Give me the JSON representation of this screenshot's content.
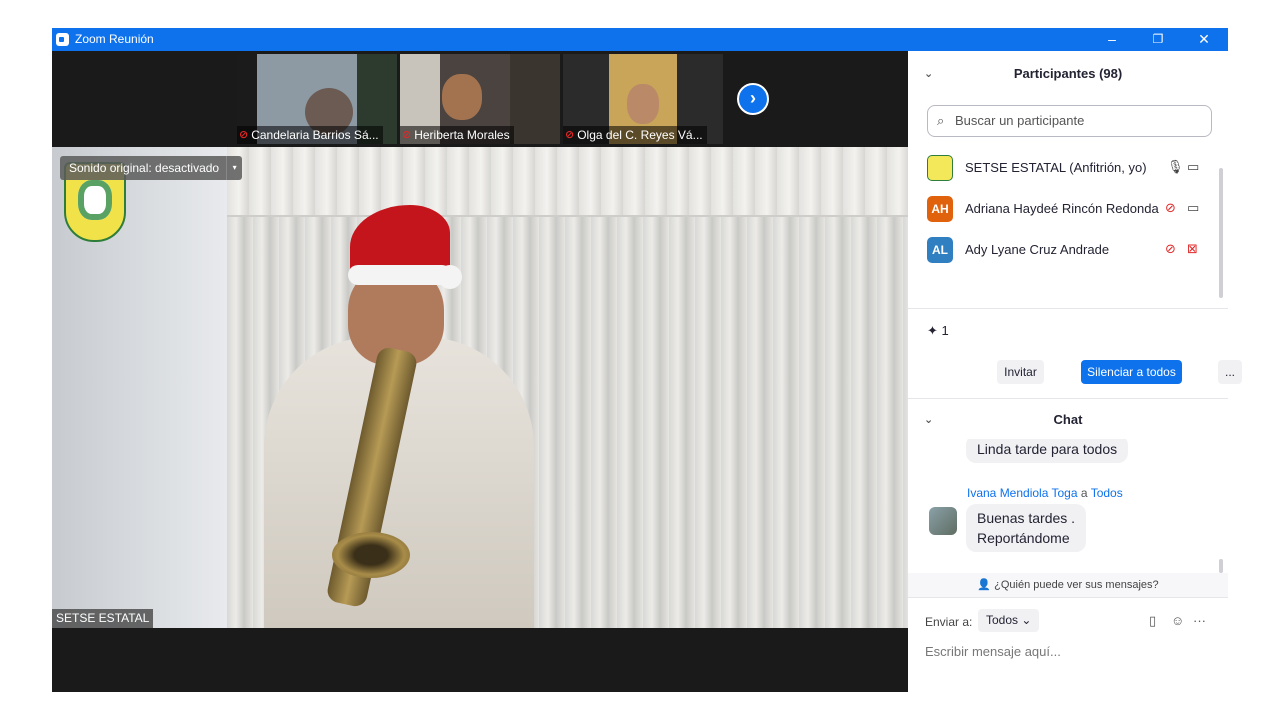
{
  "window": {
    "title": "Zoom Reunión",
    "controls": [
      "–",
      "❐",
      "✕"
    ]
  },
  "gallery": {
    "thumbnails": [
      {
        "name": "Candelaria Barrios Sá..."
      },
      {
        "name": "Heriberta Morales"
      },
      {
        "name": "Olga del C. Reyes Vá..."
      }
    ],
    "next_glyph": "›"
  },
  "main_video": {
    "original_sound_label": "Sonido original: desactivado",
    "dropdown_glyph": "▾",
    "speaker_name": "SETSE ESTATAL"
  },
  "participants": {
    "header": "Participantes (98)",
    "search_placeholder": "Buscar un participante",
    "list": [
      {
        "initials": "",
        "name": "SETSE ESTATAL (Anfitrión, yo)",
        "avatar_color": "#f2e85a",
        "mic": "unmuted",
        "video": "on"
      },
      {
        "initials": "AH",
        "name": "Adriana Haydeé Rincón Redonda",
        "avatar_color": "#e0620d",
        "mic": "muted",
        "video": "on"
      },
      {
        "initials": "AL",
        "name": "Ady Lyane Cruz Andrade",
        "avatar_color": "#2f7fc1",
        "mic": "muted",
        "video": "off"
      }
    ],
    "reaction_count": "1",
    "invite_label": "Invitar",
    "mute_all_label": "Silenciar a todos",
    "more_label": "..."
  },
  "chat": {
    "header": "Chat",
    "messages": [
      {
        "text": "Linda tarde para todos"
      },
      {
        "sender": "Ivana Mendiola Toga",
        "to_word": "a",
        "recipient": "Todos",
        "line1": "Buenas tardes .",
        "line2": "Reportándome"
      }
    ],
    "who_can_see": "¿Quién puede ver sus mensajes?",
    "send_to_label": "Enviar a:",
    "send_to_value": "Todos",
    "input_placeholder": "Escribir mensaje aquí...",
    "more_label": "···"
  },
  "colors": {
    "accent": "#0e72ed",
    "muted": "#e02828"
  }
}
